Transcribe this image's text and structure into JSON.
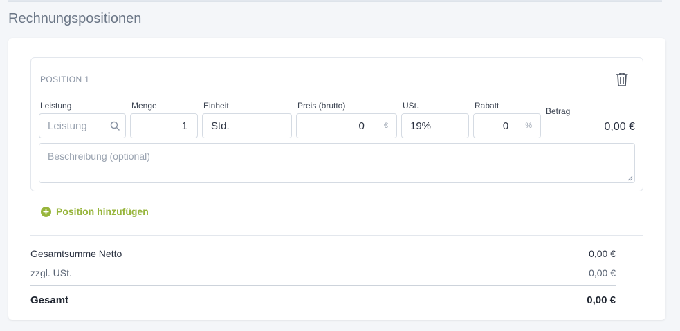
{
  "section": {
    "title": "Rechnungspositionen"
  },
  "position": {
    "heading": "POSITION 1",
    "fields": {
      "leistung": {
        "label": "Leistung",
        "placeholder": "Leistung"
      },
      "menge": {
        "label": "Menge",
        "value": "1"
      },
      "einheit": {
        "label": "Einheit",
        "value": "Std."
      },
      "preis": {
        "label": "Preis (brutto)",
        "value": "0",
        "suffix": "€"
      },
      "ust": {
        "label": "USt.",
        "value": "19%"
      },
      "rabatt": {
        "label": "Rabatt",
        "value": "0",
        "suffix": "%"
      }
    },
    "betrag": {
      "label": "Betrag",
      "value": "0,00 €"
    },
    "description": {
      "placeholder": "Beschreibung (optional)"
    }
  },
  "actions": {
    "add_position": "Position hinzufügen"
  },
  "totals": {
    "netto": {
      "label": "Gesamtsumme Netto",
      "value": "0,00 €"
    },
    "ust": {
      "label": "zzgl. USt.",
      "value": "0,00 €"
    },
    "gesamt": {
      "label": "Gesamt",
      "value": "0,00 €"
    }
  },
  "colors": {
    "accent": "#97b53b",
    "text": "#2a3140",
    "muted": "#9aa3b0",
    "border": "#d5dbe3"
  },
  "icons": {
    "search": "search-icon",
    "trash": "trash-icon",
    "add": "plus-circle-icon"
  }
}
